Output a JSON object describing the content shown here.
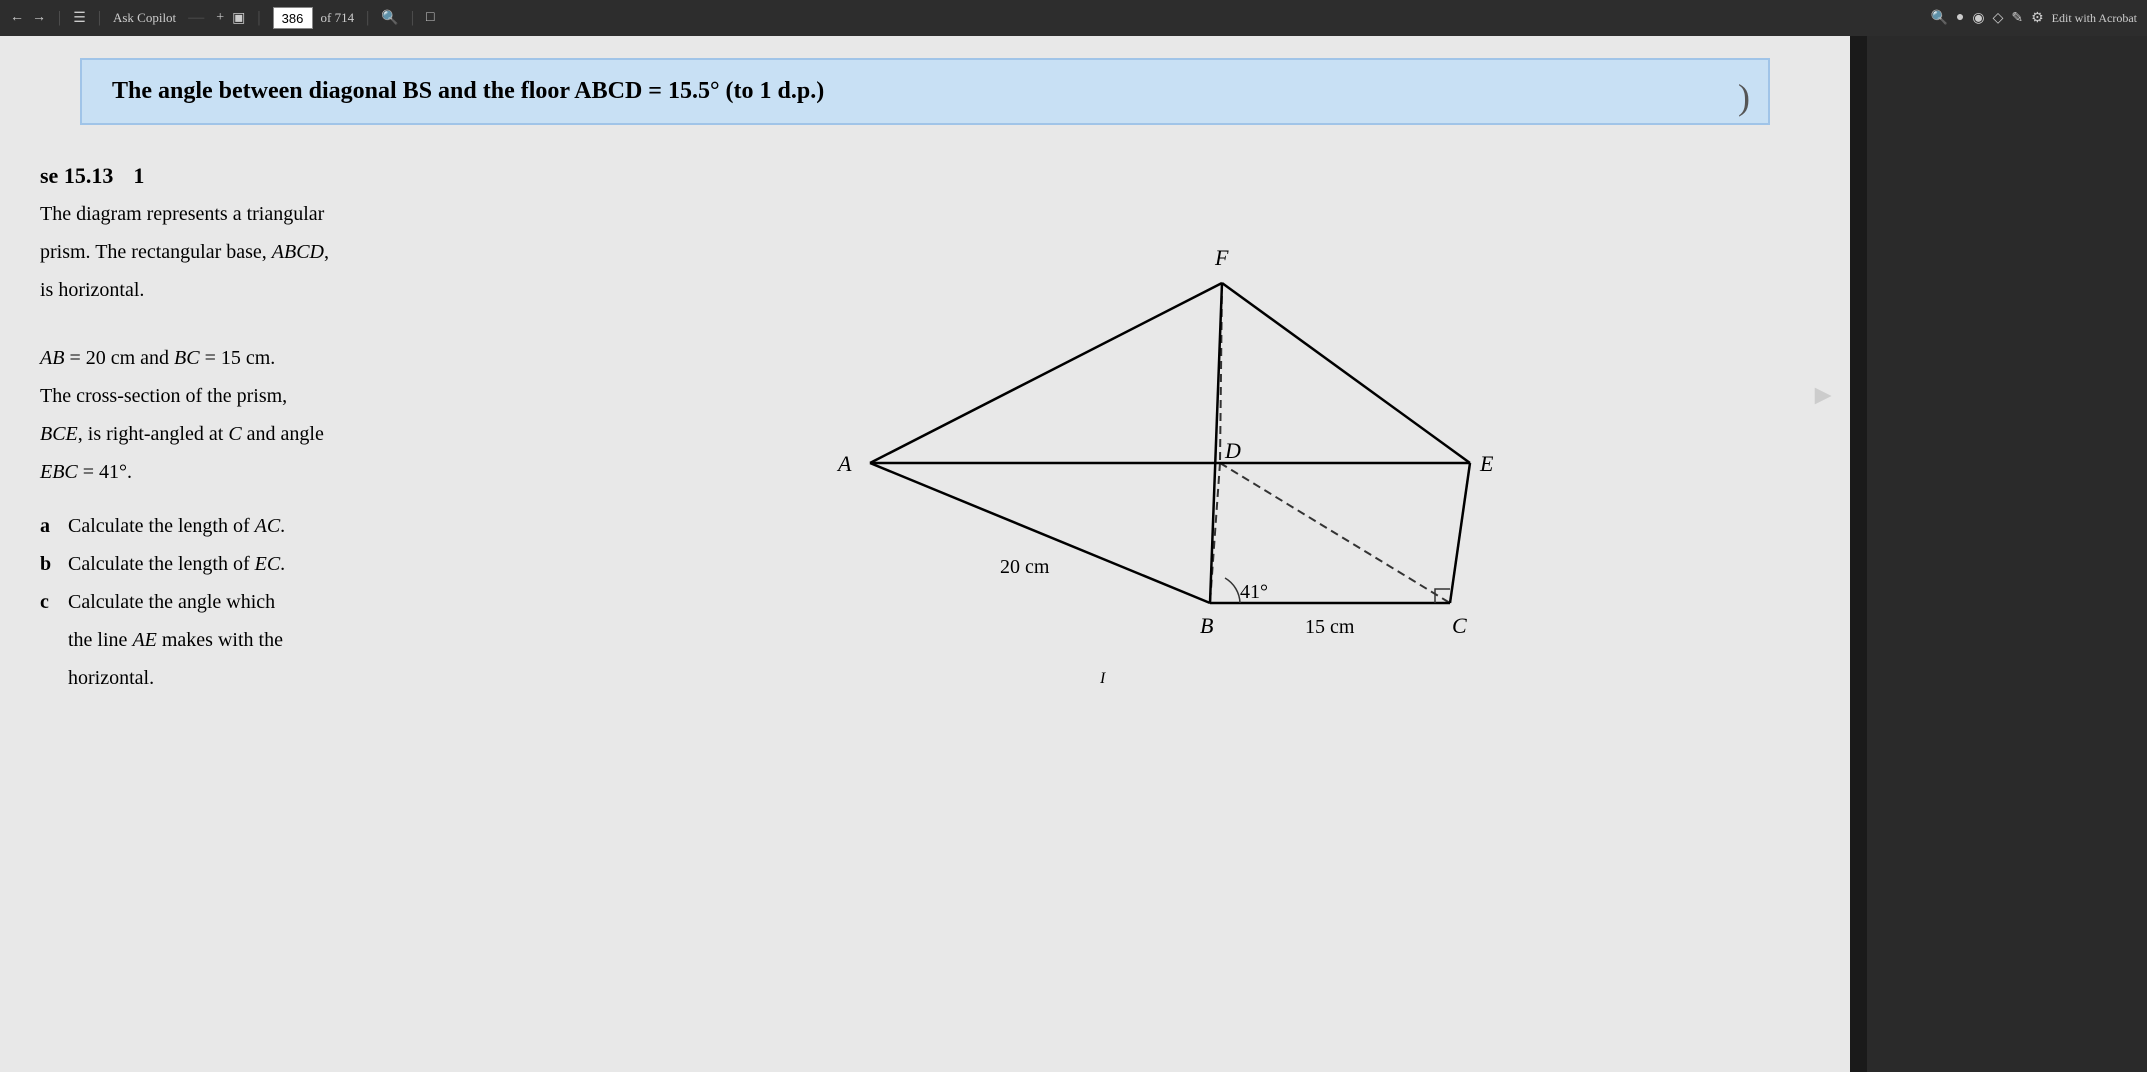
{
  "toolbar": {
    "copilot_label": "Ask Copilot",
    "page_number": "386",
    "page_total": "of 714",
    "edit_acrobat": "Edit with Acrobat"
  },
  "answer_banner": {
    "text": "The angle between diagonal BS and the floor ABCD = 15.5° (to 1 d.p.)"
  },
  "exercise": {
    "section_label": "se 15.13",
    "number": "1",
    "description_lines": [
      "The diagram represents a triangular",
      "prism. The rectangular base, ABCD,",
      "is horizontal.",
      "",
      "AB = 20 cm and BC = 15 cm.",
      "The cross-section of the prism,",
      "BCE, is right-angled at C and angle",
      "EBC = 41°."
    ],
    "parts": [
      {
        "letter": "a",
        "text": "Calculate the length of AC."
      },
      {
        "letter": "b",
        "text": "Calculate the length of EC."
      },
      {
        "letter": "c",
        "text": "Calculate the angle which the line AE makes with the horizontal."
      }
    ]
  },
  "diagram": {
    "labels": {
      "F": "F",
      "A": "A",
      "D": "D",
      "E": "E",
      "B": "B",
      "C": "C"
    },
    "measurements": {
      "AB": "20 cm",
      "BC": "15 cm",
      "angle_EBC": "41°"
    }
  }
}
